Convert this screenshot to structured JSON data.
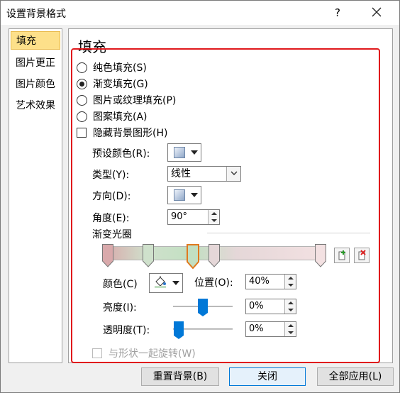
{
  "dialog": {
    "title": "设置背景格式",
    "help_label": "?"
  },
  "sidebar": {
    "items": [
      {
        "label": "填充"
      },
      {
        "label": "图片更正"
      },
      {
        "label": "图片颜色"
      },
      {
        "label": "艺术效果"
      }
    ]
  },
  "fill": {
    "section_title": "填充",
    "options": [
      {
        "label": "纯色填充(S)"
      },
      {
        "label": "渐变填充(G)"
      },
      {
        "label": "图片或纹理填充(P)"
      },
      {
        "label": "图案填充(A)"
      }
    ],
    "selected_option": "渐变填充(G)",
    "hide_bg_label": "隐藏背景图形(H)",
    "preset_label": "预设颜色(R):",
    "type_label": "类型(Y):",
    "type_value": "线性",
    "direction_label": "方向(D):",
    "angle_label": "角度(E):",
    "angle_value": "90°",
    "gradient_stops_label": "渐变光圈",
    "color_label": "颜色(C)",
    "position_label": "位置(O):",
    "position_value": "40%",
    "brightness_label": "亮度(I):",
    "brightness_value": "0%",
    "transparency_label": "透明度(T):",
    "transparency_value": "0%",
    "rotate_label": "与形状一起旋转(W)"
  },
  "footer": {
    "reset_label": "重置背景(B)",
    "close_label": "关闭",
    "apply_all_label": "全部应用(L)"
  },
  "colors": {
    "accent": "#0078d7",
    "selected_sidebar": "#fde08a",
    "highlight_frame": "#e0191c",
    "active_stop": "#e07a1f"
  },
  "icons": {
    "add_stop": "add-gradient-stop-icon",
    "remove_stop": "remove-gradient-stop-icon",
    "paint_bucket": "paint-bucket-icon",
    "close": "close-icon"
  }
}
